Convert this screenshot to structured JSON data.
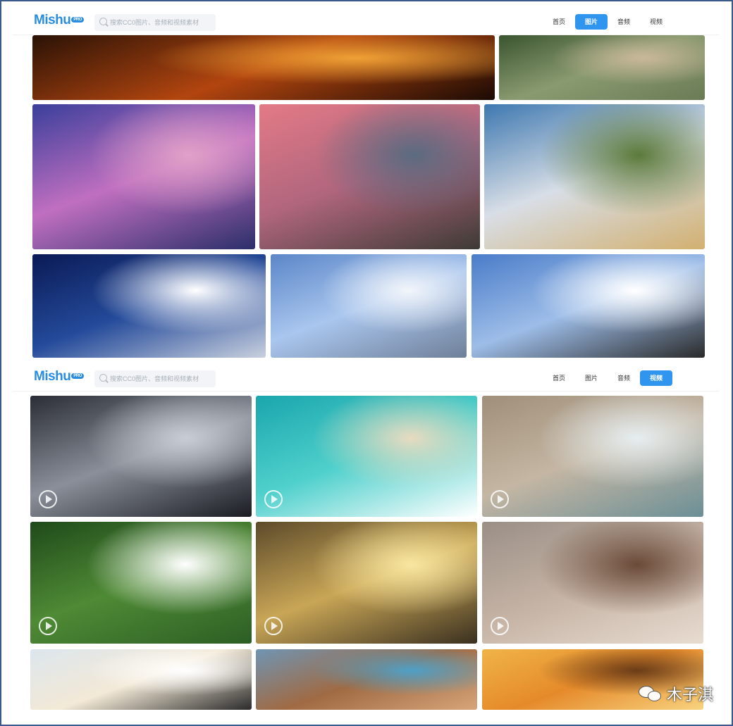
{
  "brand": {
    "name": "Mishu",
    "badge": "PRO",
    "color": "#2a8de0"
  },
  "search": {
    "placeholder": "搜索CC0图片、音频和视频素材"
  },
  "nav": {
    "items": [
      "首页",
      "图片",
      "音频",
      "视频"
    ]
  },
  "screens": [
    {
      "active_tab": "图片",
      "tiles": [
        {
          "icon": "sunset-trees-image",
          "colors": [
            "#2a1206",
            "#b2450f",
            "#f0a135",
            "#1b0a04"
          ]
        },
        {
          "icon": "cliff-valley-image",
          "colors": [
            "#3a5530",
            "#8a9a70",
            "#c9b89a",
            "#6a7b55"
          ]
        },
        {
          "icon": "boat-lake-image",
          "colors": [
            "#3a3f9b",
            "#c06fc0",
            "#e0a0c8",
            "#2b2f6a"
          ]
        },
        {
          "icon": "sea-cave-rocks-image",
          "colors": [
            "#e37a86",
            "#b1667e",
            "#5a6b80",
            "#3d3a35"
          ]
        },
        {
          "icon": "clouds-field-image",
          "colors": [
            "#3e78b0",
            "#d8dee6",
            "#5c7a3a",
            "#d2b070"
          ]
        },
        {
          "icon": "cumulus-clouds-image",
          "colors": [
            "#0a1a55",
            "#244a9a",
            "#ffffff",
            "#c8d0de"
          ]
        },
        {
          "icon": "sun-rays-clouds-image",
          "colors": [
            "#5b86c8",
            "#a9c6ee",
            "#f2f5fa",
            "#6f7f98"
          ]
        },
        {
          "icon": "light-bulbs-image",
          "colors": [
            "#4a7cc9",
            "#9dbde8",
            "#ffffff",
            "#2a2a2a"
          ]
        }
      ]
    },
    {
      "active_tab": "视频",
      "tiles": [
        {
          "icon": "volcano-video",
          "colors": [
            "#2a2d36",
            "#8a8f99",
            "#c8ccd3",
            "#1a1c22"
          ]
        },
        {
          "icon": "beach-waves-video",
          "colors": [
            "#1aa6ad",
            "#4fd0cc",
            "#e8dbc0",
            "#ffffff"
          ]
        },
        {
          "icon": "shoreline-aerial-video",
          "colors": [
            "#a08f7a",
            "#c4b6a3",
            "#e6eef0",
            "#6b8f96"
          ]
        },
        {
          "icon": "white-flowers-video",
          "colors": [
            "#1f4a1a",
            "#4f8a35",
            "#ffffff",
            "#2c5e24"
          ]
        },
        {
          "icon": "golden-sky-video",
          "colors": [
            "#5c4a2a",
            "#c9a656",
            "#f8e6a0",
            "#3a3020"
          ]
        },
        {
          "icon": "wheat-grass-video",
          "colors": [
            "#9a8f86",
            "#c4b2a4",
            "#6a4a38",
            "#e8dcd0"
          ]
        },
        {
          "icon": "city-sunrise-video",
          "colors": [
            "#dce6ee",
            "#f3e9d6",
            "#ffffff",
            "#2a2a2a"
          ]
        },
        {
          "icon": "canyon-river-video",
          "colors": [
            "#6f95b4",
            "#a06a43",
            "#4ea0c8",
            "#d7a57a"
          ]
        },
        {
          "icon": "orange-horizon-video",
          "colors": [
            "#f0b448",
            "#e58a2a",
            "#6a3c18",
            "#f8d380"
          ]
        }
      ]
    }
  ],
  "watermark": {
    "text": "木子淇"
  }
}
